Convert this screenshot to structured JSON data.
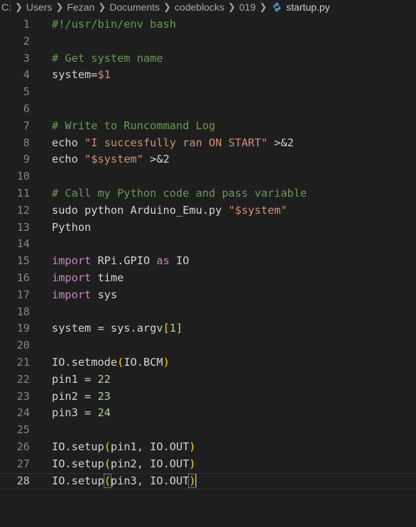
{
  "breadcrumb": {
    "segments": [
      "C:",
      "Users",
      "Fezan",
      "Documents",
      "codeblocks",
      "019"
    ],
    "file": "startup.py",
    "file_icon": "python-icon"
  },
  "colors": {
    "comment": "#6a9955",
    "keyword": "#c586c0",
    "string": "#ce9178",
    "variable": "#9cdcfe",
    "number": "#b5cea8",
    "bracket": "#ffd700",
    "plain": "#d4d4d4",
    "line_number": "#858585",
    "background": "#1e1e1e"
  },
  "editor": {
    "current_line": 28,
    "lines": [
      {
        "n": "1",
        "tokens": [
          {
            "t": "#!/usr/bin/env bash",
            "c": "comment"
          }
        ]
      },
      {
        "n": "2",
        "tokens": []
      },
      {
        "n": "3",
        "tokens": [
          {
            "t": "# Get system name",
            "c": "comment"
          }
        ]
      },
      {
        "n": "4",
        "tokens": [
          {
            "t": "system=",
            "c": "plain"
          },
          {
            "t": "$1",
            "c": "string"
          }
        ]
      },
      {
        "n": "5",
        "tokens": []
      },
      {
        "n": "6",
        "tokens": []
      },
      {
        "n": "7",
        "tokens": [
          {
            "t": "# Write to Runcommand Log",
            "c": "comment"
          }
        ]
      },
      {
        "n": "8",
        "tokens": [
          {
            "t": "echo ",
            "c": "plain"
          },
          {
            "t": "\"I succesfully ran ON START\"",
            "c": "string"
          },
          {
            "t": " >&2",
            "c": "plain"
          }
        ]
      },
      {
        "n": "9",
        "tokens": [
          {
            "t": "echo ",
            "c": "plain"
          },
          {
            "t": "\"$system\"",
            "c": "string"
          },
          {
            "t": " >&2",
            "c": "plain"
          }
        ]
      },
      {
        "n": "10",
        "tokens": []
      },
      {
        "n": "11",
        "tokens": [
          {
            "t": "# Call my Python code and pass variable",
            "c": "comment"
          }
        ]
      },
      {
        "n": "12",
        "tokens": [
          {
            "t": "sudo python Arduino_Emu.py ",
            "c": "plain"
          },
          {
            "t": "\"$system\"",
            "c": "string"
          }
        ]
      },
      {
        "n": "13",
        "tokens": [
          {
            "t": "Python",
            "c": "plain"
          }
        ]
      },
      {
        "n": "14",
        "tokens": []
      },
      {
        "n": "15",
        "tokens": [
          {
            "t": "import",
            "c": "keyword"
          },
          {
            "t": " RPi.GPIO ",
            "c": "plain"
          },
          {
            "t": "as",
            "c": "keyword"
          },
          {
            "t": " IO",
            "c": "plain"
          }
        ]
      },
      {
        "n": "16",
        "tokens": [
          {
            "t": "import",
            "c": "keyword"
          },
          {
            "t": " time",
            "c": "plain"
          }
        ]
      },
      {
        "n": "17",
        "tokens": [
          {
            "t": "import",
            "c": "keyword"
          },
          {
            "t": " sys",
            "c": "plain"
          }
        ]
      },
      {
        "n": "18",
        "tokens": []
      },
      {
        "n": "19",
        "tokens": [
          {
            "t": "system = sys.argv",
            "c": "plain"
          },
          {
            "t": "[",
            "c": "bracket"
          },
          {
            "t": "1",
            "c": "number"
          },
          {
            "t": "]",
            "c": "bracket"
          }
        ]
      },
      {
        "n": "20",
        "tokens": []
      },
      {
        "n": "21",
        "tokens": [
          {
            "t": "IO.setmode",
            "c": "plain"
          },
          {
            "t": "(",
            "c": "bracket"
          },
          {
            "t": "IO.BCM",
            "c": "plain"
          },
          {
            "t": ")",
            "c": "bracket"
          }
        ]
      },
      {
        "n": "22",
        "tokens": [
          {
            "t": "pin1 = ",
            "c": "plain"
          },
          {
            "t": "22",
            "c": "number"
          }
        ]
      },
      {
        "n": "23",
        "tokens": [
          {
            "t": "pin2 = ",
            "c": "plain"
          },
          {
            "t": "23",
            "c": "number"
          }
        ]
      },
      {
        "n": "24",
        "tokens": [
          {
            "t": "pin3 = ",
            "c": "plain"
          },
          {
            "t": "24",
            "c": "number"
          }
        ]
      },
      {
        "n": "25",
        "tokens": []
      },
      {
        "n": "26",
        "tokens": [
          {
            "t": "IO.setup",
            "c": "plain"
          },
          {
            "t": "(",
            "c": "bracket"
          },
          {
            "t": "pin1, IO.OUT",
            "c": "plain"
          },
          {
            "t": ")",
            "c": "bracket"
          }
        ]
      },
      {
        "n": "27",
        "tokens": [
          {
            "t": "IO.setup",
            "c": "plain"
          },
          {
            "t": "(",
            "c": "bracket"
          },
          {
            "t": "pin2, IO.OUT",
            "c": "plain"
          },
          {
            "t": ")",
            "c": "bracket"
          }
        ]
      },
      {
        "n": "28",
        "tokens": [
          {
            "t": "IO.setup",
            "c": "plain"
          },
          {
            "t": "(",
            "c": "bracket",
            "hl": true
          },
          {
            "t": "pin3, IO.OUT",
            "c": "plain"
          },
          {
            "t": ")",
            "c": "bracket",
            "hl": true,
            "cursor": true
          }
        ]
      }
    ]
  }
}
